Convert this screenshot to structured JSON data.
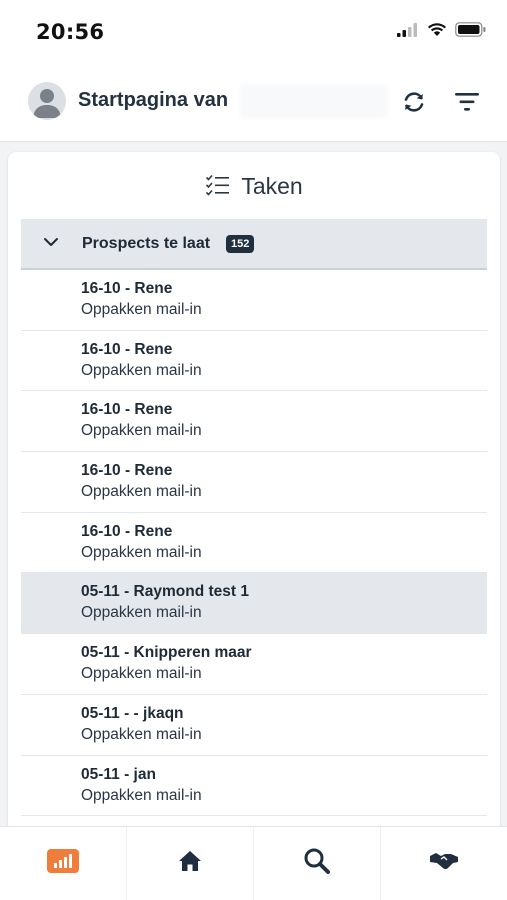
{
  "status_bar": {
    "time": "20:56",
    "icons": [
      "cellular-signal-icon",
      "wifi-icon",
      "battery-icon"
    ]
  },
  "header": {
    "title": "Startpagina van",
    "avatar_icon": "user-avatar-icon",
    "actions": [
      "refresh-icon",
      "filter-icon"
    ]
  },
  "card": {
    "title": "Taken",
    "title_icon": "checklist-icon",
    "group": {
      "label": "Prospects te laat",
      "count": "152",
      "expanded": true
    },
    "tasks": [
      {
        "title": "16-10 - Rene",
        "subtitle": "Oppakken mail-in"
      },
      {
        "title": "16-10 - Rene",
        "subtitle": "Oppakken mail-in"
      },
      {
        "title": "16-10 - Rene",
        "subtitle": "Oppakken mail-in"
      },
      {
        "title": "16-10 - Rene",
        "subtitle": "Oppakken mail-in"
      },
      {
        "title": "16-10 - Rene",
        "subtitle": "Oppakken mail-in"
      },
      {
        "title": "05-11 - Raymond test 1",
        "subtitle": "Oppakken mail-in",
        "selected": true
      },
      {
        "title": "05-11 - Knipperen maar",
        "subtitle": "Oppakken mail-in"
      },
      {
        "title": "05-11 - - jkaqn",
        "subtitle": "Oppakken mail-in"
      },
      {
        "title": "05-11 - jan",
        "subtitle": "Oppakken mail-in"
      }
    ]
  },
  "tabbar": {
    "tabs": [
      {
        "name": "dashboard",
        "icon": "bar-chart-icon",
        "active": true
      },
      {
        "name": "home",
        "icon": "home-icon",
        "active": false
      },
      {
        "name": "search",
        "icon": "search-icon",
        "active": false
      },
      {
        "name": "deals",
        "icon": "handshake-icon",
        "active": false
      }
    ]
  },
  "colors": {
    "accent": "#ef7d3c",
    "header_bg": "#e4e8ec",
    "badge_bg": "#1f2f3f",
    "text_dark": "#1f2a37"
  }
}
